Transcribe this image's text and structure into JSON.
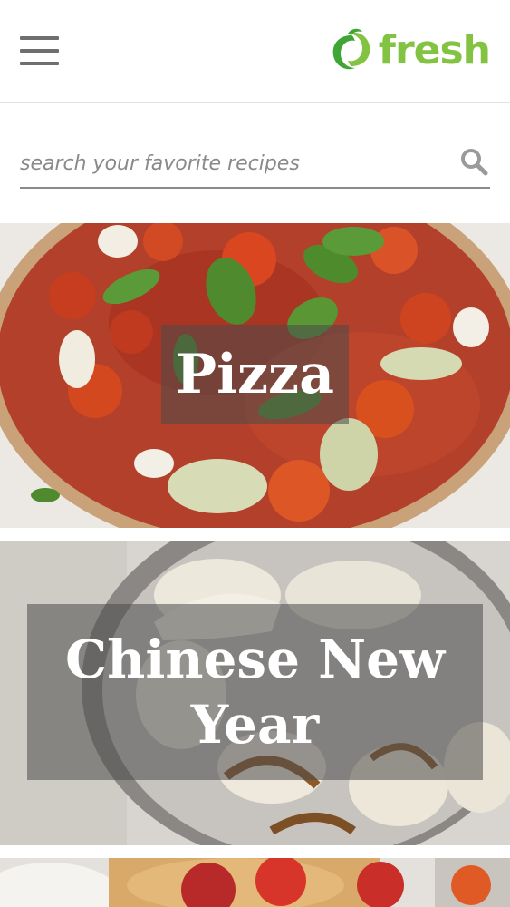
{
  "header": {
    "menu_icon": "hamburger-menu-icon",
    "logo": {
      "text": "fresh",
      "color": "#82c341",
      "icon": "woolworths-logo-icon"
    }
  },
  "search": {
    "placeholder": "search your favorite recipes",
    "value": "",
    "icon": "search-icon"
  },
  "categories": [
    {
      "title": "Pizza"
    },
    {
      "title": "Chinese New Year"
    },
    {
      "title": ""
    }
  ],
  "colors": {
    "accent": "#82c341",
    "overlay": "#4b4b4b"
  }
}
